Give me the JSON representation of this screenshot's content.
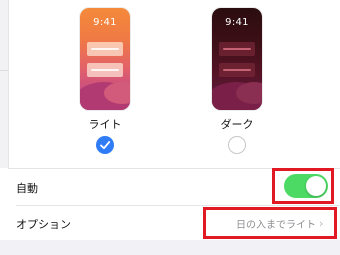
{
  "appearance": {
    "light": {
      "label": "ライト",
      "time": "9:41",
      "selected": true
    },
    "dark": {
      "label": "ダーク",
      "time": "9:41",
      "selected": false
    }
  },
  "settings": {
    "automatic": {
      "label": "自動",
      "enabled": true
    },
    "options": {
      "label": "オプション",
      "value": "日の入までライト"
    }
  },
  "colors": {
    "accent": "#2f7cf6",
    "toggle_on": "#4cd964",
    "highlight": "#e01923"
  }
}
